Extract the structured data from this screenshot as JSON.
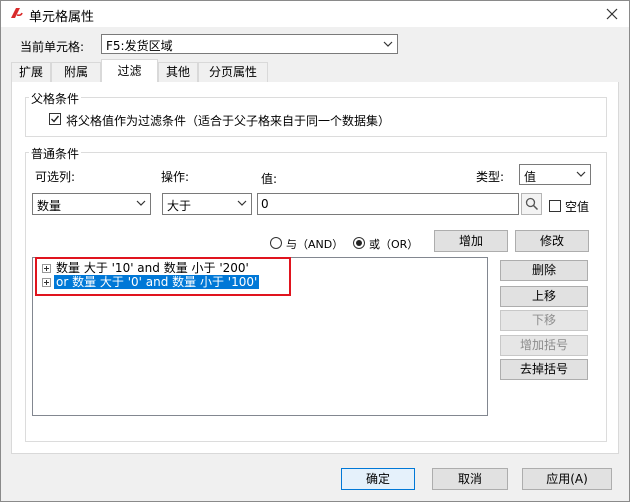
{
  "window": {
    "title": "单元格属性"
  },
  "current_cell": {
    "label": "当前单元格:",
    "value": "F5:发货区域"
  },
  "tabs": [
    "扩展",
    "附属",
    "过滤",
    "其他",
    "分页属性"
  ],
  "parent_group": {
    "title": "父格条件",
    "checkbox_label": "将父格值作为过滤条件（适合于父子格来自于同一个数据集）",
    "checked": true
  },
  "normal_group": {
    "title": "普通条件",
    "column_label": "可选列:",
    "operation_label": "操作:",
    "value_label": "值:",
    "type_label": "类型:",
    "type_value": "值",
    "column_value": "数量",
    "operation_value": "大于",
    "value_input": "0",
    "empty_label": "空值"
  },
  "logic": {
    "and_label": "与（AND）",
    "or_label": "或（OR）",
    "selected": "or"
  },
  "buttons": {
    "add": "增加",
    "modify": "修改",
    "delete": "删除",
    "move_up": "上移",
    "move_down": "下移",
    "add_paren": "增加括号",
    "remove_paren": "去掉括号",
    "ok": "确定",
    "cancel": "取消",
    "apply": "应用(A)"
  },
  "conditions": [
    {
      "text": "数量 大于 '10' and 数量 小于 '200'",
      "selected": false
    },
    {
      "text": "or 数量 大于 '0' and 数量 小于 '100'",
      "selected": true
    }
  ]
}
